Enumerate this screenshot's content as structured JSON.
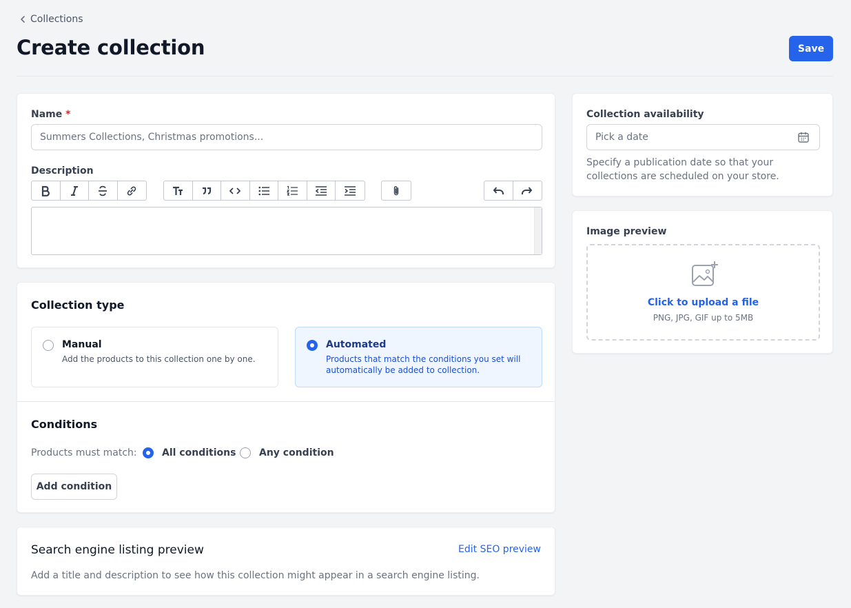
{
  "breadcrumb": {
    "label": "Collections"
  },
  "page": {
    "title": "Create collection"
  },
  "actions": {
    "save_label": "Save"
  },
  "details": {
    "name_label": "Name",
    "name_required": "*",
    "name_placeholder": "Summers Collections, Christmas promotions...",
    "name_value": "",
    "description_label": "Description",
    "description_value": "",
    "toolbar_icons": [
      "bold-icon",
      "italic-icon",
      "strikethrough-icon",
      "link-icon",
      "heading-icon",
      "quote-icon",
      "code-icon",
      "bullet-list-icon",
      "numbered-list-icon",
      "outdent-icon",
      "indent-icon",
      "attach-icon",
      "undo-icon",
      "redo-icon"
    ]
  },
  "collection_type": {
    "title": "Collection type",
    "options": [
      {
        "label": "Manual",
        "description": "Add the products to this collection one by one.",
        "selected": false
      },
      {
        "label": "Automated",
        "description": "Products that match the conditions you set will automatically be added to collection.",
        "selected": true
      }
    ]
  },
  "conditions": {
    "title": "Conditions",
    "match_label": "Products must match:",
    "match_options": [
      {
        "label": "All conditions",
        "selected": true
      },
      {
        "label": "Any condition",
        "selected": false
      }
    ],
    "add_label": "Add condition"
  },
  "seo": {
    "title": "Search engine listing preview",
    "edit_label": "Edit SEO preview",
    "description": "Add a title and description to see how this collection might appear in a search engine listing."
  },
  "availability": {
    "label": "Collection availability",
    "date_placeholder": "Pick a date",
    "date_value": "",
    "help": "Specify a publication date so that your collections are scheduled on your store."
  },
  "image_preview": {
    "label": "Image preview",
    "upload_label": "Click to upload a file",
    "hint": "PNG, JPG, GIF up to 5MB"
  },
  "colors": {
    "primary": "#2563eb",
    "required": "#dc2626",
    "selected_bg": "#eff6ff",
    "page_bg": "#f3f4f6"
  }
}
